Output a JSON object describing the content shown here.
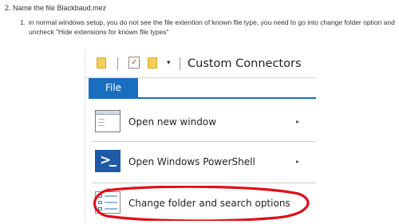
{
  "instructions": {
    "step2_number": "2.",
    "step2_text": "Name the file Blackbaud.mez",
    "substep1_number": "1.",
    "substep1_text": "in normal windows setup, you do not see the file extention of known file type, you need to go into change folder option and uncheck \"Hide extensions for known file types\""
  },
  "explorer": {
    "dropdown_glyph": "▾",
    "window_title": "Custom Connectors",
    "file_tab_label": "File",
    "menu_items": [
      {
        "label": "Open new window",
        "icon": "new-window-icon",
        "has_submenu": true
      },
      {
        "label": "Open Windows PowerShell",
        "icon": "powershell-icon",
        "has_submenu": true
      },
      {
        "label": "Change folder and search options",
        "icon": "folder-options-icon",
        "has_submenu": false
      }
    ],
    "submenu_arrow": "▸",
    "powershell_glyph": ">"
  },
  "annotation": {
    "type": "hand-drawn ellipse",
    "color": "#e0101a",
    "highlights": "Change folder and search options"
  }
}
